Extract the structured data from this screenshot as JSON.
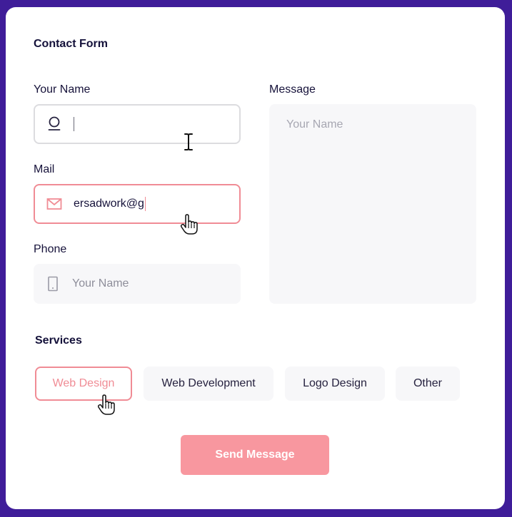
{
  "form": {
    "title": "Contact Form",
    "name_field": {
      "label": "Your Name",
      "value": "",
      "icon": "user-icon"
    },
    "mail_field": {
      "label": "Mail",
      "value": "ersadwork@g",
      "icon": "mail-icon"
    },
    "phone_field": {
      "label": "Phone",
      "placeholder": "Your Name",
      "icon": "phone-icon"
    },
    "message_field": {
      "label": "Message",
      "placeholder": "Your Name"
    }
  },
  "services": {
    "title": "Services",
    "options": [
      {
        "label": "Web Design",
        "selected": true
      },
      {
        "label": "Web Development",
        "selected": false
      },
      {
        "label": "Logo Design",
        "selected": false
      },
      {
        "label": "Other",
        "selected": false
      }
    ]
  },
  "send_button": {
    "label": "Send Message"
  },
  "colors": {
    "background": "#3f1d99",
    "accent": "#f08c95",
    "button": "#f8979f",
    "field_bg": "#f7f7f9"
  }
}
